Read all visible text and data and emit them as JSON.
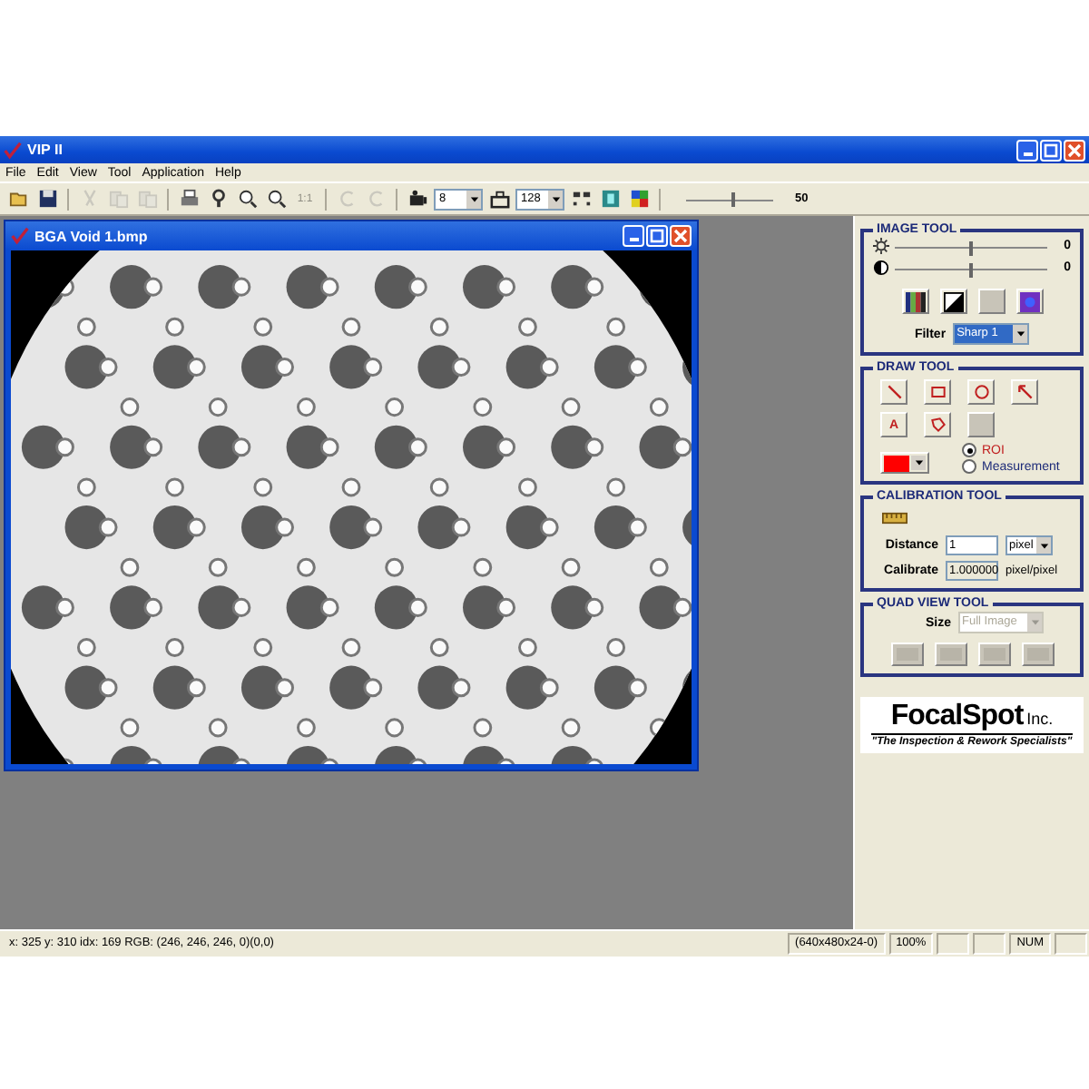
{
  "window": {
    "title": "VIP II"
  },
  "menu": [
    "File",
    "Edit",
    "View",
    "Tool",
    "Application",
    "Help"
  ],
  "toolbar": [
    {
      "kind": "open",
      "disabled": false
    },
    {
      "kind": "save",
      "disabled": false
    },
    {
      "kind": "separator"
    },
    {
      "kind": "cut",
      "disabled": true
    },
    {
      "kind": "copy",
      "disabled": true
    },
    {
      "kind": "paste",
      "disabled": true
    },
    {
      "kind": "separator"
    },
    {
      "kind": "print",
      "disabled": false
    },
    {
      "kind": "help",
      "disabled": false
    },
    {
      "kind": "zoomin",
      "disabled": false
    },
    {
      "kind": "zoomout",
      "disabled": false
    },
    {
      "kind": "text",
      "label": "1:1",
      "disabled": true
    },
    {
      "kind": "separator"
    },
    {
      "kind": "rotleft",
      "disabled": true
    },
    {
      "kind": "rotright",
      "disabled": true
    },
    {
      "kind": "separator"
    },
    {
      "kind": "camera",
      "disabled": false
    },
    {
      "kind": "combo",
      "value": "8"
    },
    {
      "kind": "grab",
      "disabled": false
    },
    {
      "kind": "combo",
      "value": "128"
    },
    {
      "kind": "grid",
      "disabled": false
    },
    {
      "kind": "tile",
      "disabled": false
    },
    {
      "kind": "palette",
      "disabled": false
    },
    {
      "kind": "separator"
    },
    {
      "kind": "slider",
      "level": 0.55
    },
    {
      "kind": "reading",
      "text": "50"
    }
  ],
  "document": {
    "title": "BGA Void 1.bmp"
  },
  "image_tool": {
    "title": "IMAGE TOOL",
    "sliders": [
      {
        "kind": "brightness",
        "level": 0.5,
        "reading": "0"
      },
      {
        "kind": "contrast",
        "level": 0.5,
        "reading": "0"
      }
    ],
    "buttons": [
      {
        "kind": "bars",
        "disabled": false
      },
      {
        "kind": "invert",
        "disabled": false
      },
      {
        "kind": "blank",
        "disabled": true
      },
      {
        "kind": "gradient",
        "disabled": false
      }
    ],
    "filter": {
      "label": "Filter",
      "value": "Sharp 1"
    }
  },
  "draw_tool": {
    "title": "DRAW TOOL",
    "tools": [
      {
        "kind": "line",
        "disabled": false
      },
      {
        "kind": "rect",
        "disabled": false
      },
      {
        "kind": "ellipse",
        "disabled": false
      },
      {
        "kind": "arrow",
        "disabled": false
      },
      {
        "kind": "text",
        "label": "A",
        "disabled": false
      },
      {
        "kind": "polygon",
        "disabled": false
      },
      {
        "kind": "blank",
        "disabled": true
      }
    ],
    "modes": [
      {
        "label": "ROI",
        "selected": true
      },
      {
        "label": "Measurement",
        "selected": false
      }
    ]
  },
  "calibration_tool": {
    "title": "CALIBRATION TOOL",
    "distance": {
      "label": "Distance",
      "value": "1",
      "unit": "pixel"
    },
    "calibrate": {
      "label": "Calibrate",
      "value": "1.000000",
      "unit": "pixel/pixel"
    }
  },
  "quad_view_tool": {
    "title": "QUAD VIEW TOOL",
    "size_label": "Size",
    "size_value": "Full Image",
    "disabled": true,
    "buttons": [
      {
        "disabled": true
      },
      {
        "disabled": true
      },
      {
        "disabled": true
      },
      {
        "disabled": true
      }
    ]
  },
  "logo": {
    "name": "FocalSpot",
    "suffix": "Inc.",
    "tagline": "\"The Inspection & Rework Specialists\""
  },
  "status_bar": [
    "x: 325 y: 310 idx: 169  RGB: (246, 246, 246,   0)(0,0)",
    "(640x480x24-0)",
    "100%",
    "NUM"
  ]
}
